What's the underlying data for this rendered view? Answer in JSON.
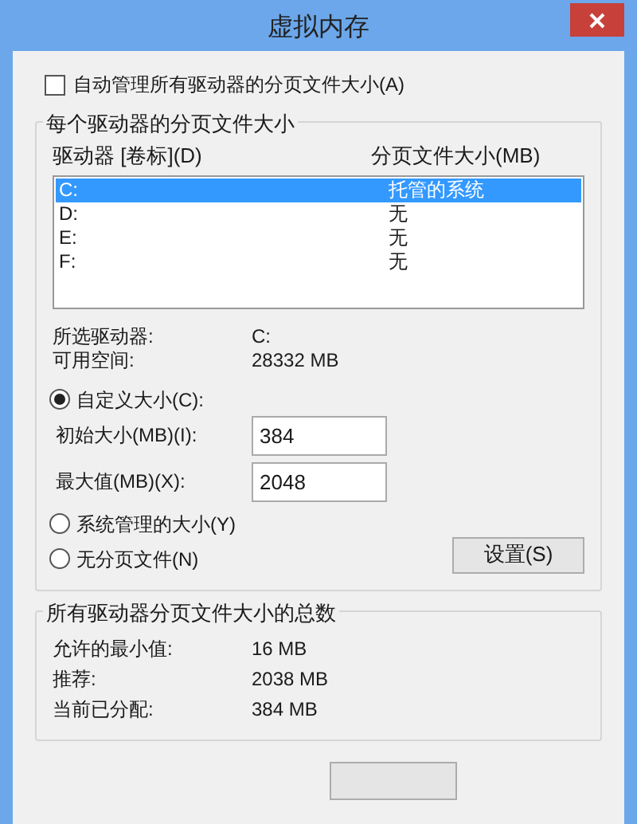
{
  "window": {
    "title": "虚拟内存"
  },
  "auto_manage": {
    "label": "自动管理所有驱动器的分页文件大小(A)",
    "checked": false
  },
  "per_drive": {
    "title": "每个驱动器的分页文件大小",
    "columns": [
      "驱动器 [卷标](D)",
      "分页文件大小(MB)"
    ],
    "drives": [
      {
        "drive": "C:",
        "paging_size": "托管的系统",
        "selected": true
      },
      {
        "drive": "D:",
        "paging_size": "无",
        "selected": false
      },
      {
        "drive": "E:",
        "paging_size": "无",
        "selected": false
      },
      {
        "drive": "F:",
        "paging_size": "无",
        "selected": false
      }
    ],
    "info": [
      {
        "label": "所选驱动器:",
        "value": "C:"
      },
      {
        "label": "可用空间:",
        "value": "28332 MB"
      }
    ],
    "custom_size": {
      "label": "自定义大小(C):",
      "selected": true
    },
    "initial_size": {
      "label": "初始大小(MB)(I):",
      "value": "384"
    },
    "maximum_size": {
      "label": "最大值(MB)(X):",
      "value": "2048"
    },
    "system_managed": {
      "label": "系统管理的大小(Y)",
      "selected": false
    },
    "no_paging_file": {
      "label": "无分页文件(N)",
      "selected": false
    },
    "set_button": "设置(S)"
  },
  "totals": {
    "title": "所有驱动器分页文件大小的总数",
    "rows": [
      {
        "label": "允许的最小值:",
        "value": "16 MB"
      },
      {
        "label": "推荐:",
        "value": "2038 MB"
      },
      {
        "label": "当前已分配:",
        "value": "384 MB"
      }
    ]
  }
}
